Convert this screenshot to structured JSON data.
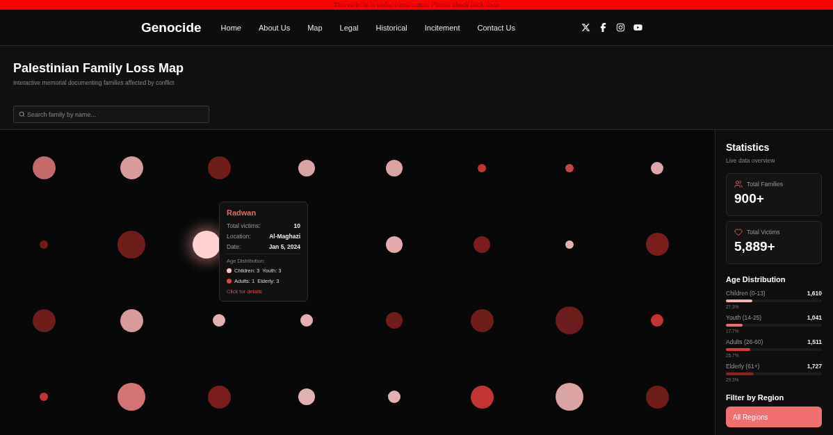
{
  "banner": {
    "text": "This website is under construction. Please check back soon"
  },
  "nav": {
    "brand": "Genocide",
    "links": [
      "Home",
      "About Us",
      "Map",
      "Legal",
      "Historical",
      "Incitement",
      "Contact Us"
    ],
    "social": [
      {
        "kind": "x"
      },
      {
        "kind": "facebook"
      },
      {
        "kind": "instagram"
      },
      {
        "kind": "youtube"
      }
    ]
  },
  "header": {
    "title": "Palestinian Family Loss Map",
    "subtitle": "Interactive memorial documenting families affected by conflict",
    "search": {
      "placeholder": "Search family by name..."
    }
  },
  "map": {
    "rows": [
      [
        {
          "kind": "l",
          "color": "#c46a6a",
          "selected": false
        },
        {
          "kind": "l",
          "color": "#d99a9a",
          "selected": false
        },
        {
          "kind": "l",
          "color": "#6e1c1c",
          "selected": false
        },
        {
          "kind": "m",
          "color": "#dba4a4",
          "selected": false
        },
        {
          "kind": "m",
          "color": "#dba4a4",
          "selected": false
        },
        {
          "kind": "xs",
          "color": "#c23434",
          "selected": false
        },
        {
          "kind": "xs",
          "color": "#c24646",
          "selected": false
        },
        {
          "kind": "s",
          "color": "#dba6ac",
          "selected": false
        }
      ],
      [
        {
          "kind": "xs",
          "color": "#6e1c1c",
          "selected": false
        },
        {
          "kind": "xl",
          "color": "#6e1c1c",
          "selected": false
        },
        {
          "kind": "xl",
          "color": "#ffd2d2",
          "selected": true
        },
        {
          "kind": "m",
          "color": "#e2aaaa",
          "selected": false
        },
        {
          "kind": "m",
          "color": "#7a1c1c",
          "selected": false
        },
        {
          "kind": "xs",
          "color": "#e2b2b2",
          "selected": false
        },
        {
          "kind": "l",
          "color": "#7a1c1c",
          "selected": false
        }
      ],
      [
        {
          "kind": "l",
          "color": "#6e1c1c",
          "selected": false
        },
        {
          "kind": "l",
          "color": "#d99a9a",
          "selected": false
        },
        {
          "kind": "s",
          "color": "#e2b2b2",
          "selected": false
        },
        {
          "kind": "s",
          "color": "#e2b2b2",
          "selected": false
        },
        {
          "kind": "m",
          "color": "#6e1c1c",
          "selected": false
        },
        {
          "kind": "l",
          "color": "#6e1c1c",
          "selected": false
        },
        {
          "kind": "xl",
          "color": "#6e1c1c",
          "selected": false
        },
        {
          "kind": "s",
          "color": "#c23434",
          "selected": false
        }
      ],
      [
        {
          "kind": "xs",
          "color": "#c23434",
          "selected": false
        },
        {
          "kind": "xl",
          "color": "#d47474",
          "selected": false
        },
        {
          "kind": "l",
          "color": "#7a1c1c",
          "selected": false
        },
        {
          "kind": "m",
          "color": "#e2b2b2",
          "selected": false
        },
        {
          "kind": "s",
          "color": "#e2b2b2",
          "selected": false
        },
        {
          "kind": "l",
          "color": "#c23434",
          "selected": false
        },
        {
          "kind": "xl",
          "color": "#dba4a4",
          "selected": false
        },
        {
          "kind": "l",
          "color": "#6e1c1c",
          "selected": false
        }
      ]
    ],
    "tooltip": {
      "name": "Radwan",
      "fields": [
        {
          "label": "Total victims:",
          "value": "10"
        },
        {
          "label": "Location:",
          "value": "Al-Maghazi"
        },
        {
          "label": "Date:",
          "value": "Jan 5, 2024"
        }
      ],
      "age_title": "Age Distribution:",
      "groups": [
        {
          "color": "#f5c6c6",
          "items": [
            "Children: 3",
            "Youth: 3"
          ]
        },
        {
          "color": "#d94545",
          "items": [
            "Adults: 1",
            "Elderly: 3"
          ]
        }
      ],
      "link": "Click for details"
    }
  },
  "sidebar": {
    "title": "Statistics",
    "subtitle": "Live data overview",
    "cards": [
      {
        "kind": "families",
        "label": "Total Families",
        "value": "900+"
      },
      {
        "kind": "victims",
        "label": "Total Victims",
        "value": "5,889+"
      }
    ],
    "age_title": "Age Distribution",
    "ages": [
      {
        "label": "Children (0-13)",
        "count": "1,610",
        "percent": "27.3%",
        "level": 0.273,
        "color": "#f4b3b3"
      },
      {
        "label": "Youth (14-25)",
        "count": "1,041",
        "percent": "17.7%",
        "level": 0.177,
        "color": "#ec6b6b"
      },
      {
        "label": "Adults (26-60)",
        "count": "1,511",
        "percent": "25.7%",
        "level": 0.257,
        "color": "#d23c3c"
      },
      {
        "label": "Elderly (61+)",
        "count": "1,727",
        "percent": "29.3%",
        "level": 0.293,
        "color": "#8a2222"
      }
    ],
    "filter_title": "Filter by Region",
    "filter_button": "All Regions"
  }
}
